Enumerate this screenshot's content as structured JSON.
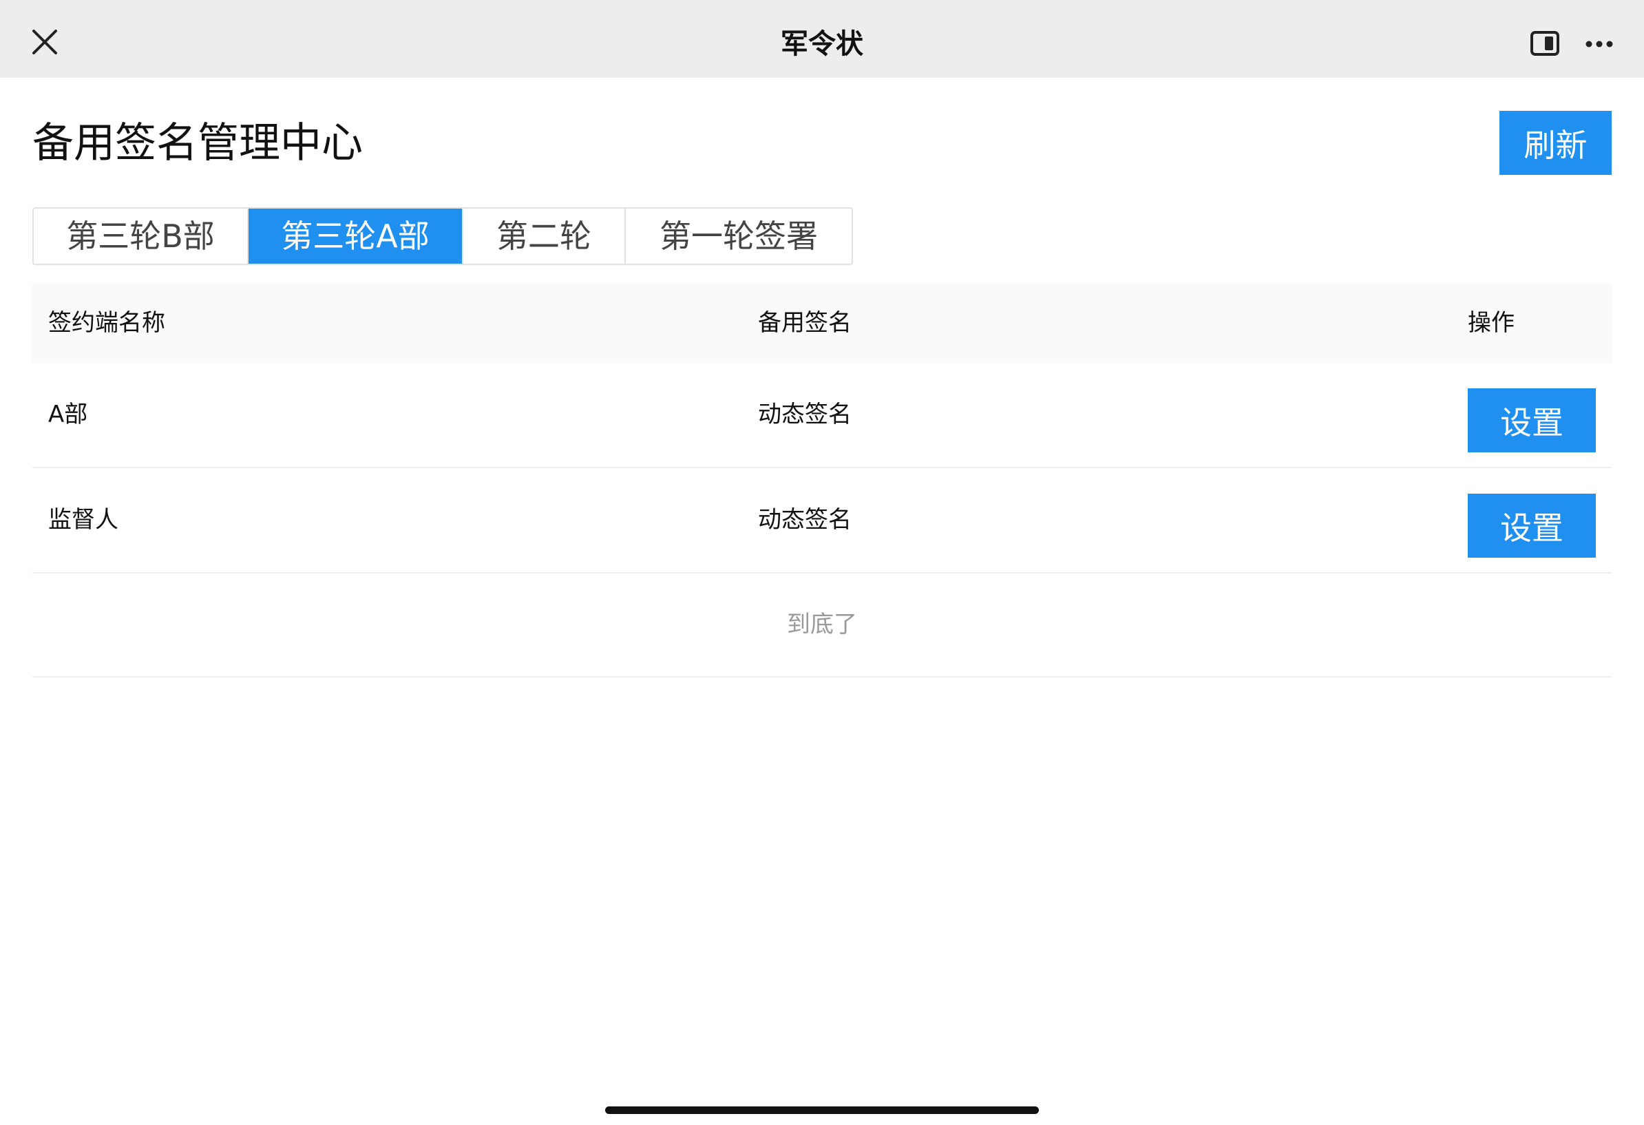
{
  "navbar": {
    "title": "军令状",
    "close_icon": "close-icon",
    "split_icon": "split-view-icon",
    "more_icon": "more-dots-icon"
  },
  "header": {
    "title": "备用签名管理中心",
    "refresh_label": "刷新"
  },
  "tabs": {
    "active_index": 1,
    "items": [
      {
        "label": "第三轮B部"
      },
      {
        "label": "第三轮A部"
      },
      {
        "label": "第二轮"
      },
      {
        "label": "第一轮签署"
      }
    ]
  },
  "table": {
    "columns": [
      "签约端名称",
      "备用签名",
      "操作"
    ],
    "rows": [
      {
        "name": "A部",
        "signature": "动态签名",
        "action": "设置"
      },
      {
        "name": "监督人",
        "signature": "动态签名",
        "action": "设置"
      }
    ],
    "end_text": "到底了"
  },
  "colors": {
    "accent": "#1f8ff0",
    "navbar_bg": "#ededed",
    "header_row_bg": "#fafafa"
  }
}
